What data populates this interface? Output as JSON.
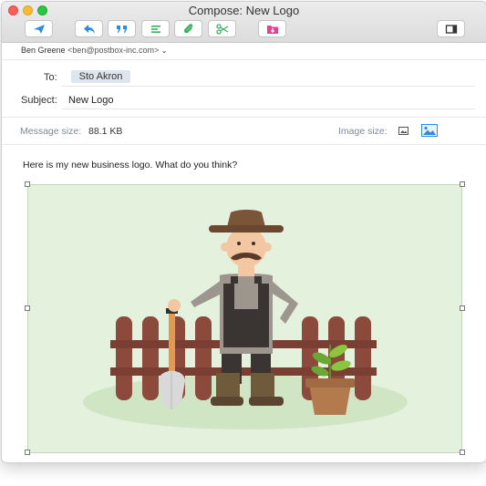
{
  "window": {
    "title": "Compose: New Logo"
  },
  "toolbar": {
    "buttons": [
      {
        "icon": "send-icon",
        "color": "#2f8be0"
      },
      {
        "icon": "reply-icon",
        "color": "#2f8be0"
      },
      {
        "icon": "quote-icon",
        "color": "#2f8be0"
      },
      {
        "icon": "format-align-icon",
        "color": "#3bb061"
      },
      {
        "icon": "paperclip-icon",
        "color": "#3bb061"
      },
      {
        "icon": "scissors-icon",
        "color": "#3bb061"
      },
      {
        "icon": "folder-download-icon",
        "color": "#e0468f"
      },
      {
        "icon": "sidebar-toggle-icon",
        "color": "#333333"
      }
    ]
  },
  "from": {
    "name": "Ben Greene",
    "address": "<ben@postbox-inc.com>"
  },
  "compose": {
    "to_label": "To:",
    "to_recipient": "Sto Akron",
    "subject_label": "Subject:",
    "subject_value": "New Logo"
  },
  "attachment_bar": {
    "message_size_label": "Message size:",
    "message_size_value": "88.1 KB",
    "image_size_label": "Image size:"
  },
  "body": {
    "text": "Here is my new business logo. What do you think?"
  },
  "colors": {
    "accent_blue": "#2f8be0",
    "image_background": "#e4f1dc"
  }
}
